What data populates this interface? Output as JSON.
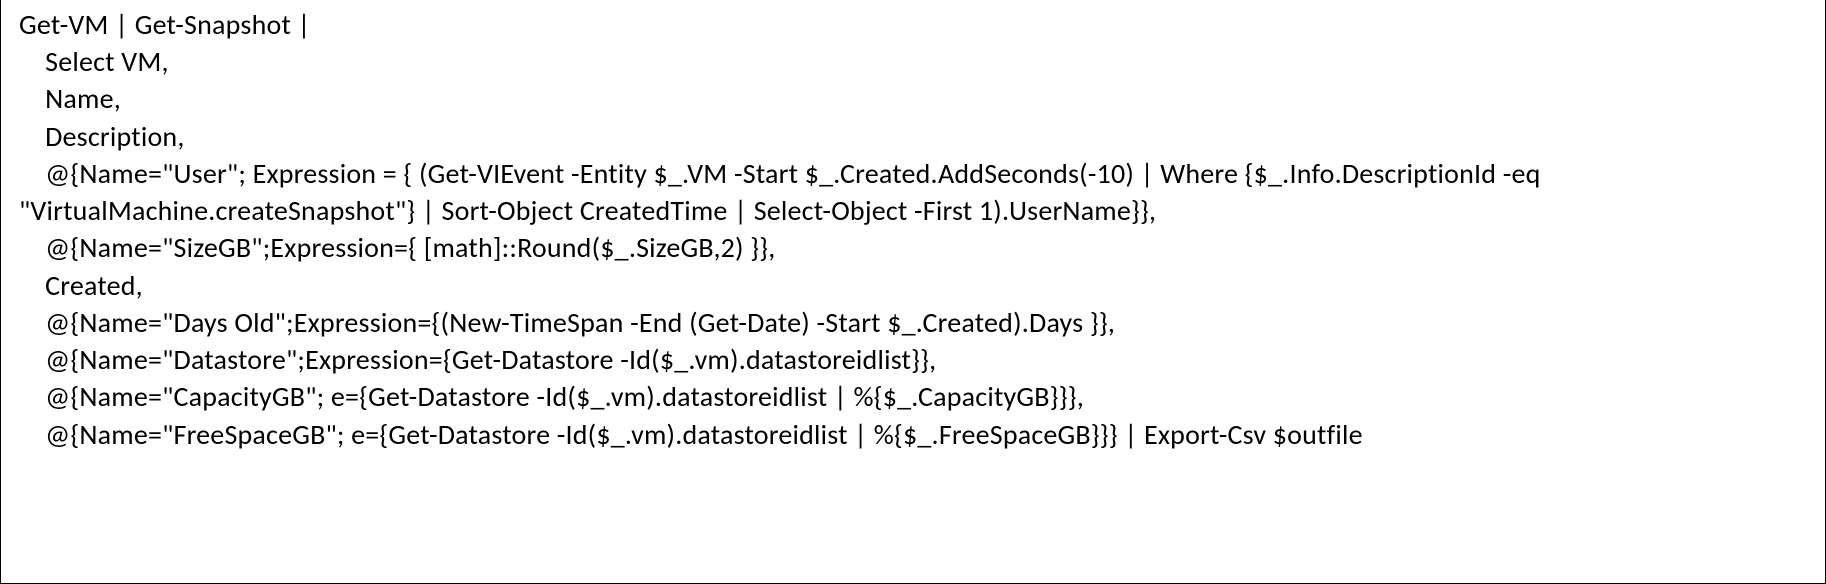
{
  "code": {
    "line1": "Get-VM | Get-Snapshot |",
    "line2": "    Select VM,",
    "line3": "    Name,",
    "line4": "    Description,",
    "line5": "    @{Name=\"User\"; Expression = { (Get-VIEvent -Entity $_.VM -Start $_.Created.AddSeconds(-10) | Where {$_.Info.DescriptionId -eq \"VirtualMachine.createSnapshot\"} | Sort-Object CreatedTime | Select-Object -First 1).UserName}},",
    "line6": "    @{Name=\"SizeGB\";Expression={ [math]::Round($_.SizeGB,2) }},",
    "line7": "    Created,",
    "line8": "    @{Name=\"Days Old\";Expression={(New-TimeSpan -End (Get-Date) -Start $_.Created).Days }},",
    "line9": "    @{Name=\"Datastore\";Expression={Get-Datastore -Id($_.vm).datastoreidlist}},",
    "line10": "    @{Name=\"CapacityGB\"; e={Get-Datastore -Id($_.vm).datastoreidlist | %{$_.CapacityGB}}},",
    "line11": "    @{Name=\"FreeSpaceGB\"; e={Get-Datastore -Id($_.vm).datastoreidlist | %{$_.FreeSpaceGB}}} | Export-Csv $outfile"
  }
}
